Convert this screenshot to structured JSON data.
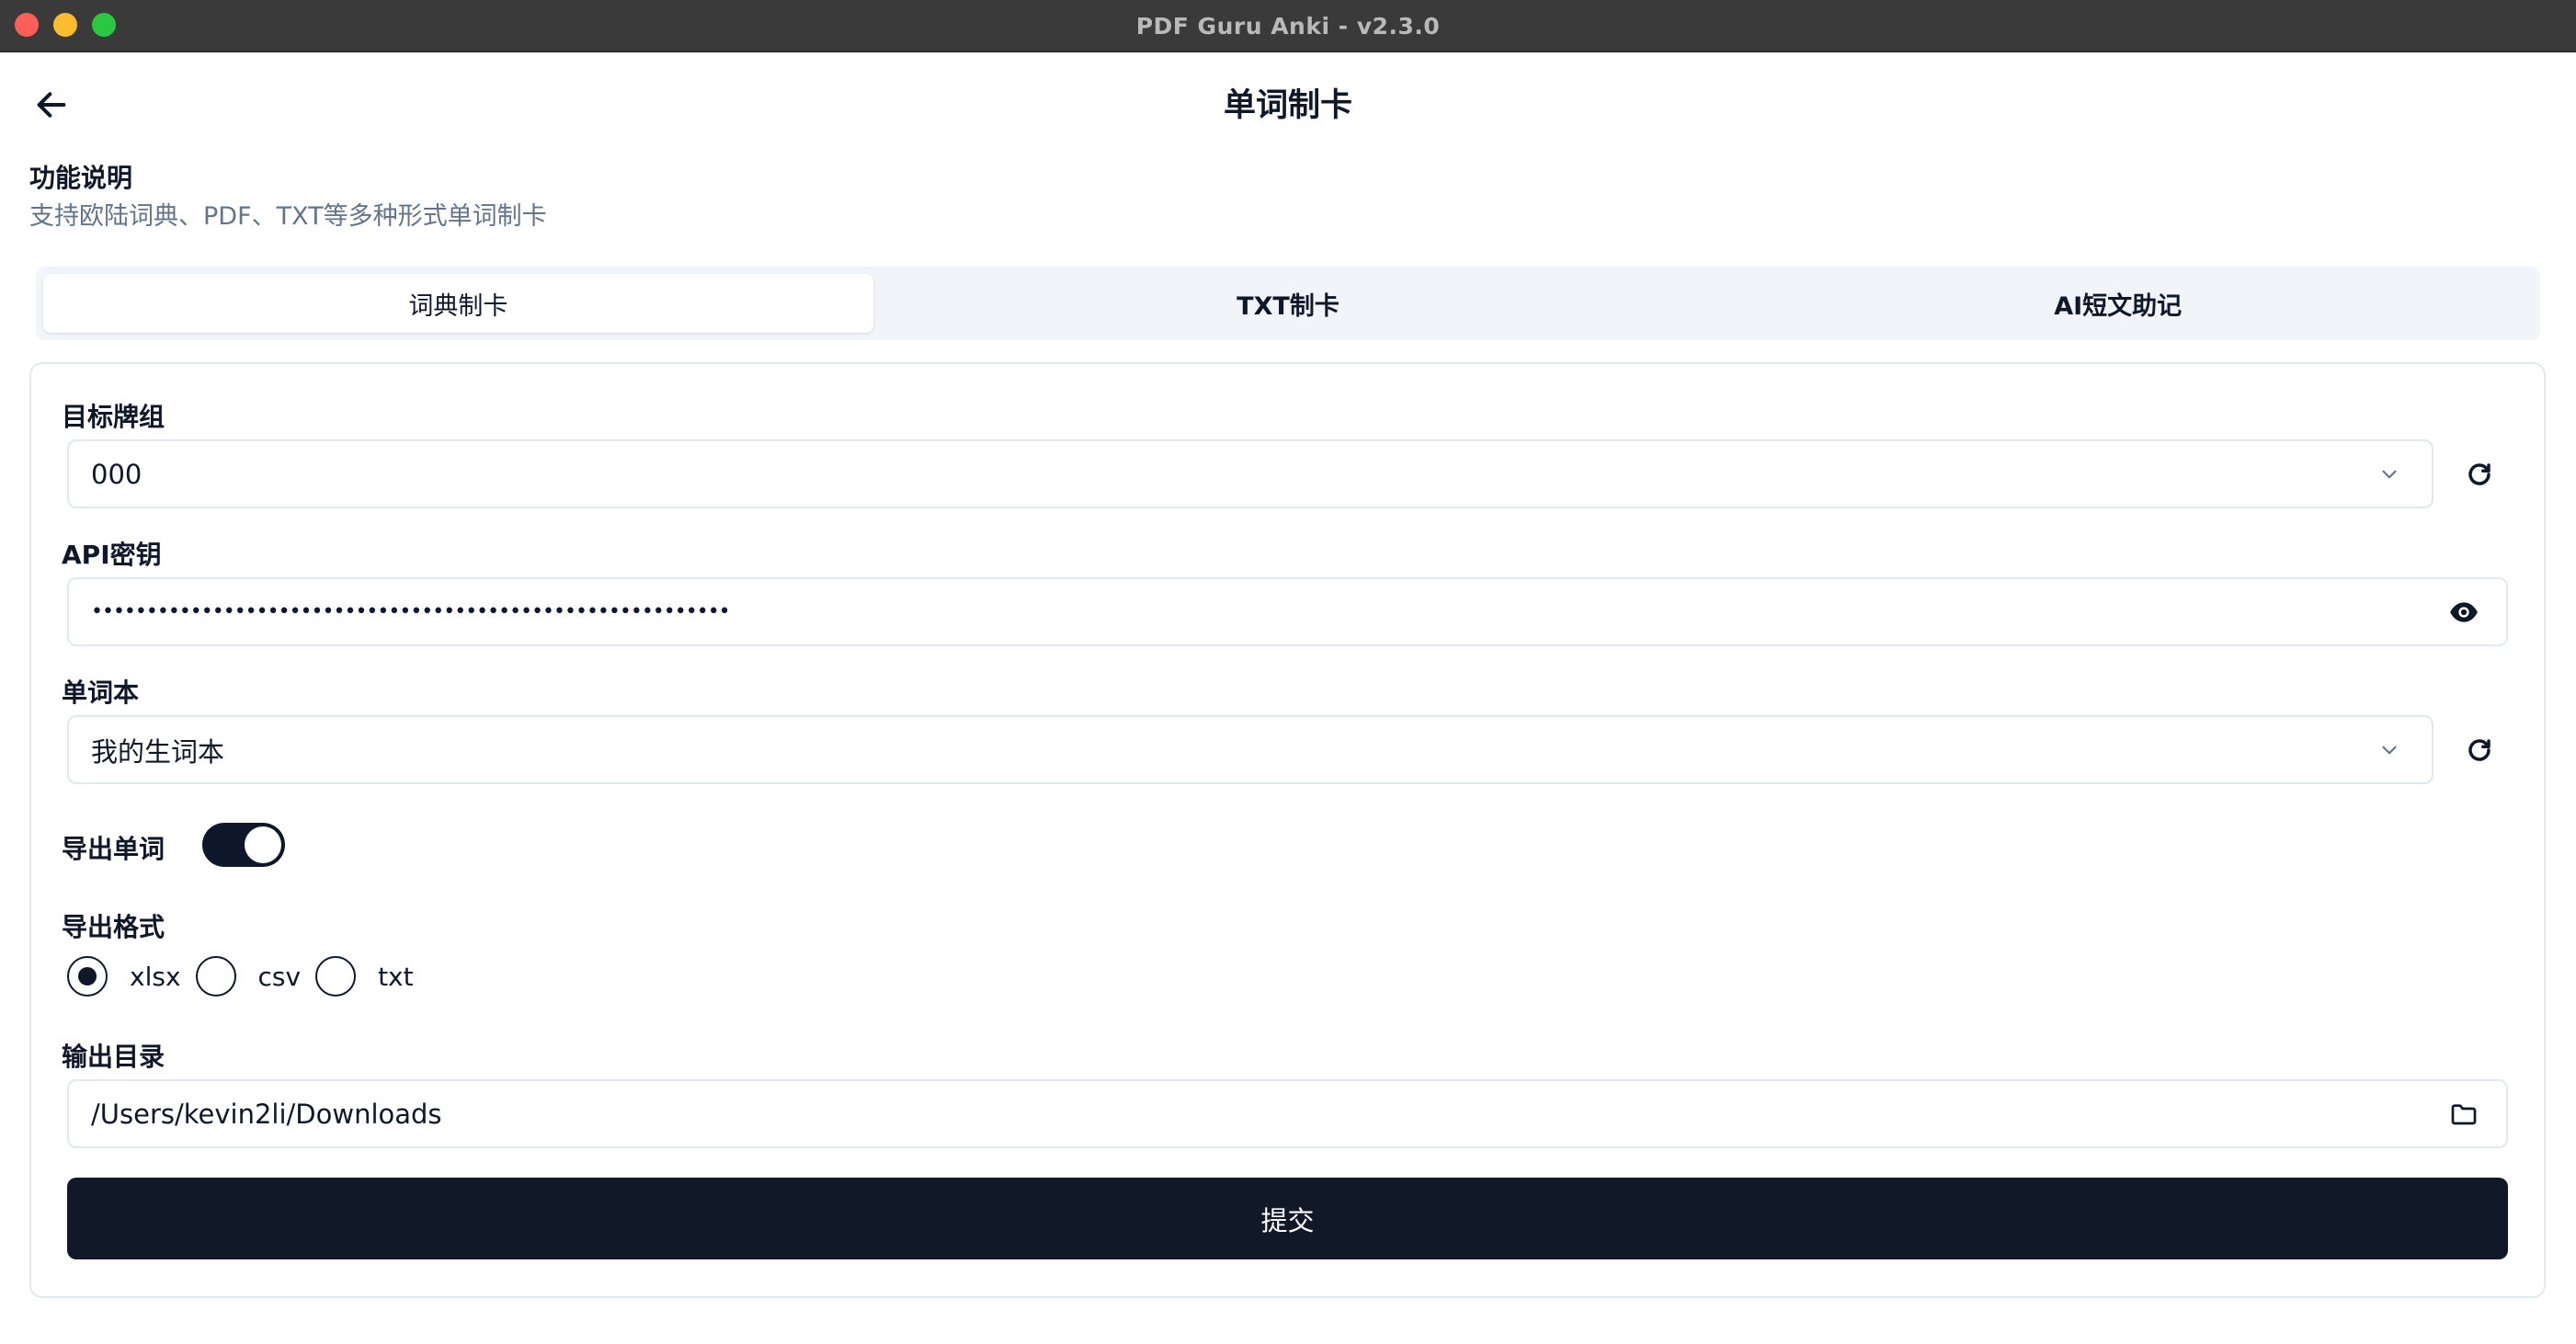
{
  "window": {
    "title": "PDF Guru Anki - v2.3.0",
    "controls": [
      "close-icon",
      "minimize-icon",
      "zoom-icon"
    ]
  },
  "header": {
    "title": "单词制卡",
    "back_icon": "arrow-left-icon"
  },
  "description": {
    "title": "功能说明",
    "text": "支持欧陆词典、PDF、TXT等多种形式单词制卡"
  },
  "tabs": [
    {
      "label": "词典制卡",
      "active": true
    },
    {
      "label": "TXT制卡",
      "active": false
    },
    {
      "label": "AI短文助记",
      "active": false
    }
  ],
  "form": {
    "deck": {
      "label": "目标牌组",
      "value": "000",
      "icon": "chevron-down-icon",
      "refresh_icon": "refresh-icon"
    },
    "api_key": {
      "label": "API密钥",
      "value": "••••••••••••••••••••••••••••••••••••••••••••••••••••••••••",
      "icon": "eye-icon"
    },
    "wordbook": {
      "label": "单词本",
      "value": "我的生词本",
      "icon": "chevron-down-icon",
      "refresh_icon": "refresh-icon"
    },
    "export_words": {
      "label": "导出单词",
      "enabled": true
    },
    "export_format": {
      "label": "导出格式",
      "options": [
        {
          "label": "xlsx",
          "selected": true
        },
        {
          "label": "csv",
          "selected": false
        },
        {
          "label": "txt",
          "selected": false
        }
      ]
    },
    "output_dir": {
      "label": "输出目录",
      "value": "/Users/kevin2li/Downloads",
      "icon": "folder-icon"
    },
    "submit_label": "提交"
  },
  "colors": {
    "primary": "#0f172a",
    "submit": "#111827",
    "muted_text": "#64748b",
    "border": "#e2e8f0",
    "tab_bg": "#f1f5f9",
    "titlebar": "#3a3a3a"
  }
}
